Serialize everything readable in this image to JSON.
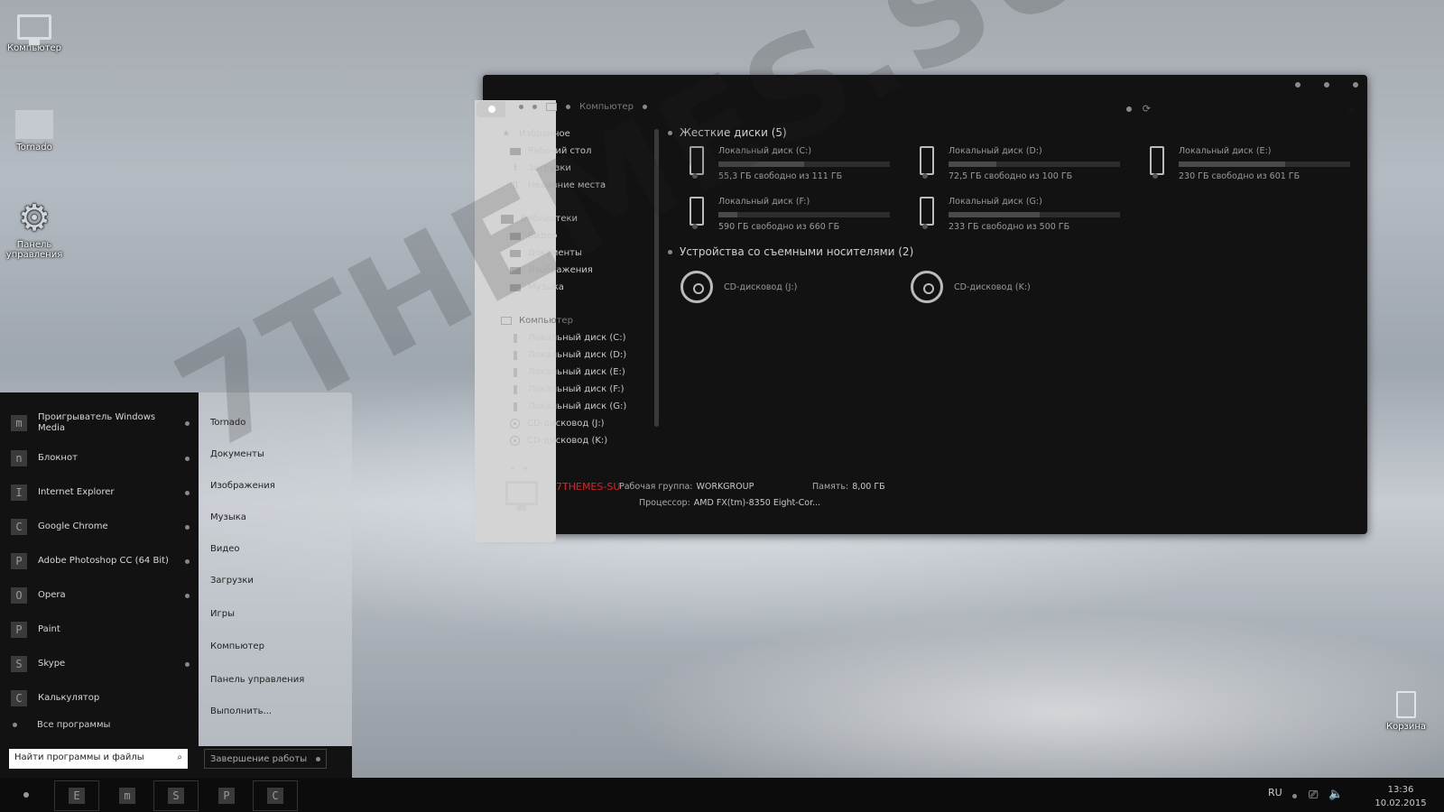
{
  "watermark": "7THEMES.SU",
  "desktop": {
    "icons": [
      {
        "label": "Компьютер"
      },
      {
        "label": "Tornado"
      },
      {
        "label": "Панель управления"
      },
      {
        "label": "Корзина"
      }
    ]
  },
  "explorer": {
    "breadcrumb": "Компьютер",
    "nav": {
      "favorites": "Избранное",
      "desktop": "Рабочий стол",
      "downloads": "Загрузки",
      "recent": "Недавние места",
      "libraries": "Библиотеки",
      "video": "Видео",
      "documents": "Документы",
      "images": "Изображения",
      "music": "Музыка",
      "computer": "Компьютер",
      "drive_c": "Локальный диск (C:)",
      "drive_d": "Локальный диск (D:)",
      "drive_e": "Локальный диск (E:)",
      "drive_f": "Локальный диск (F:)",
      "drive_g": "Локальный диск (G:)",
      "cd_j": "CD-дисковод (J:)",
      "cd_k": "CD-дисковод (K:)"
    },
    "hard_disks_header": "Жесткие диски (5)",
    "drives": [
      {
        "name": "Локальный диск (C:)",
        "free": "55,3 ГБ свободно из 111 ГБ",
        "used_fraction": 0.5
      },
      {
        "name": "Локальный диск (D:)",
        "free": "72,5 ГБ свободно из 100 ГБ",
        "used_fraction": 0.28
      },
      {
        "name": "Локальный диск (E:)",
        "free": "230 ГБ свободно из 601 ГБ",
        "used_fraction": 0.62
      },
      {
        "name": "Локальный диск (F:)",
        "free": "590 ГБ свободно из 660 ГБ",
        "used_fraction": 0.11
      },
      {
        "name": "Локальный диск (G:)",
        "free": "233 ГБ свободно из 500 ГБ",
        "used_fraction": 0.53
      }
    ],
    "removable_header": "Устройства со съемными носителями (2)",
    "cd_drives": [
      {
        "name": "CD-дисковод (J:)"
      },
      {
        "name": "CD-дисковод (K:)"
      }
    ],
    "details": {
      "computer_name": "7THEMES-SU",
      "workgroup_label": "Рабочая группа:",
      "workgroup_value": "WORKGROUP",
      "memory_label": "Память:",
      "memory_value": "8,00 ГБ",
      "cpu_label": "Процессор:",
      "cpu_value": "AMD FX(tm)-8350 Eight-Cor..."
    }
  },
  "start_menu": {
    "programs": [
      {
        "letter": "m",
        "name": "Проигрыватель Windows Media",
        "arrow": true
      },
      {
        "letter": "n",
        "name": "Блокнот",
        "arrow": true
      },
      {
        "letter": "I",
        "name": "Internet Explorer",
        "arrow": true
      },
      {
        "letter": "C",
        "name": "Google Chrome",
        "arrow": true
      },
      {
        "letter": "P",
        "name": "Adobe Photoshop CC (64 Bit)",
        "arrow": true
      },
      {
        "letter": "O",
        "name": "Opera",
        "arrow": true
      },
      {
        "letter": "P",
        "name": "Paint",
        "arrow": false
      },
      {
        "letter": "S",
        "name": "Skype",
        "arrow": true
      },
      {
        "letter": "C",
        "name": "Калькулятор",
        "arrow": false
      }
    ],
    "all_programs": "Все программы",
    "search_placeholder": "Найти программы и файлы",
    "places": [
      "Tornado",
      "Документы",
      "Изображения",
      "Музыка",
      "Видео",
      "Загрузки",
      "Игры",
      "Компьютер",
      "Панель управления",
      "Выполнить..."
    ],
    "shutdown": "Завершение работы"
  },
  "taskbar": {
    "pinned": [
      {
        "letter": "E"
      },
      {
        "letter": "m"
      },
      {
        "letter": "S"
      },
      {
        "letter": "P"
      },
      {
        "letter": "C"
      }
    ],
    "language": "RU",
    "time": "13:36",
    "date": "10.02.2015"
  }
}
